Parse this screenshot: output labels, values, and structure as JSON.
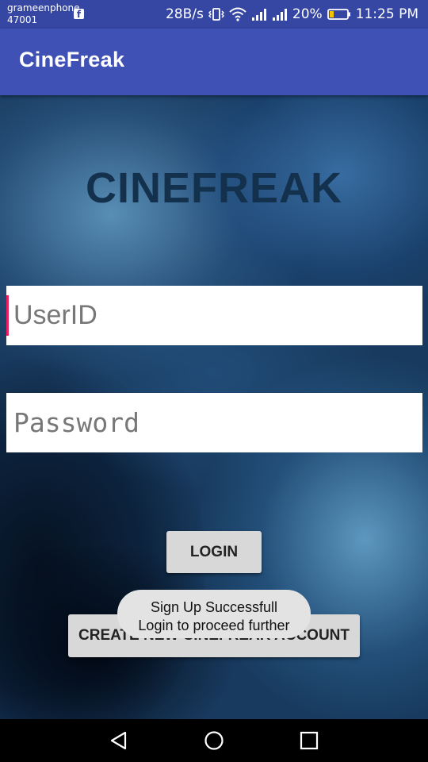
{
  "status_bar": {
    "carrier_name": "grameenphone",
    "carrier_code": "47001",
    "notification_icon": "facebook-icon",
    "network_speed": "28B/s",
    "battery": "20%",
    "time": "11:25 PM",
    "icons": [
      "vibrate-icon",
      "wifi-icon",
      "signal-icon",
      "signal-icon",
      "battery-icon"
    ]
  },
  "app_bar": {
    "title": "CineFreak"
  },
  "login": {
    "brand": "CINEFREAK",
    "userid_placeholder": "UserID",
    "password_placeholder": "Password",
    "login_button": "LOGIN",
    "create_account_button": "CREATE NEW CINEFREAK ACCOUNT"
  },
  "toast": {
    "line1": "Sign Up Successfull",
    "line2": "Login to proceed further"
  },
  "nav_bar": {
    "icons": [
      "back-icon",
      "home-icon",
      "recents-icon"
    ]
  },
  "colors": {
    "status_bar": "#3546a3",
    "app_bar": "#3f51b5",
    "accent_cursor": "#e91e63",
    "brand_text": "#13304c",
    "button_bg": "#d8d8d8",
    "toast_bg": "#e3e3e3"
  }
}
